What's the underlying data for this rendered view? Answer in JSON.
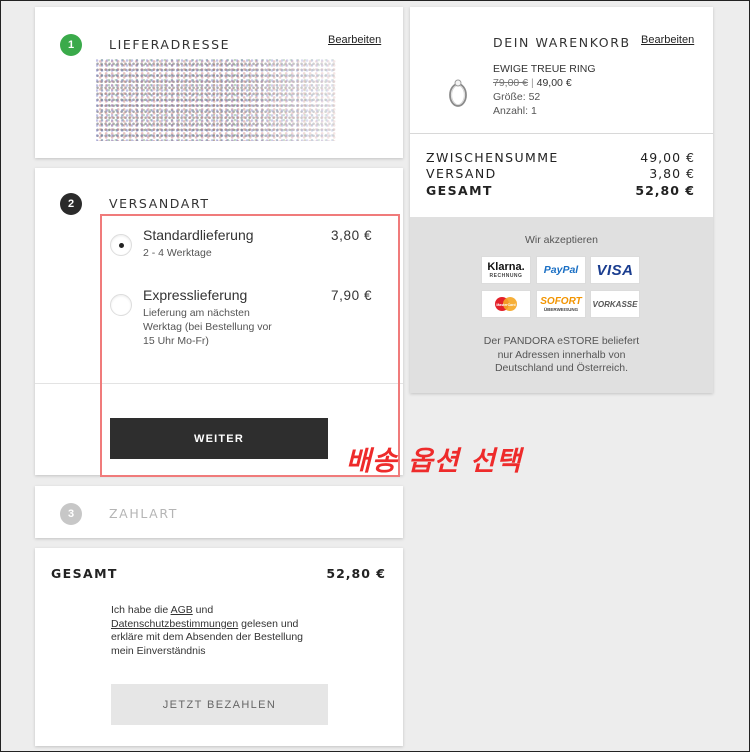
{
  "steps": {
    "address": {
      "number": "1",
      "title": "LIEFERADRESSE",
      "edit": "Bearbeiten"
    },
    "shipping": {
      "number": "2",
      "title": "VERSANDART"
    },
    "payment": {
      "number": "3",
      "title": "ZAHLART"
    }
  },
  "shipping_options": [
    {
      "name": "Standardlieferung",
      "sub": "2 - 4 Werktage",
      "price": "3,80 €",
      "selected": true
    },
    {
      "name": "Expresslieferung",
      "sub": "Lieferung am nächsten Werktag (bei Bestellung vor 15 Uhr Mo-Fr)",
      "price": "7,90 €",
      "selected": false
    }
  ],
  "weiter_button": "WEITER",
  "annotation": "배송 옵션 선택",
  "total_card": {
    "label": "GESAMT",
    "value": "52,80 €",
    "terms_prefix": "Ich habe die",
    "agb": "AGB",
    "und": "und",
    "privacy": "Datenschutzbestimmungen",
    "terms_suffix": "gelesen und erkläre mit dem Absenden der Bestellung mein Einverständnis",
    "pay_button": "JETZT BEZAHLEN"
  },
  "cart": {
    "title": "DEIN WARENKORB",
    "edit": "Bearbeiten",
    "item": {
      "name": "EWIGE TREUE RING",
      "old_price": "79,00 €",
      "separator": "|",
      "price": "49,00 €",
      "size": "Größe: 52",
      "qty": "Anzahl: 1"
    },
    "summary": {
      "subtotal_label": "ZWISCHENSUMME",
      "subtotal": "49,00 €",
      "shipping_label": "VERSAND",
      "shipping": "3,80 €",
      "total_label": "GESAMT",
      "total": "52,80 €"
    },
    "accept_title": "Wir akzeptieren",
    "payment_logos": [
      {
        "name": "Klarna.",
        "sub": "RECHNUNG"
      },
      {
        "name": "PayPal"
      },
      {
        "name": "VISA"
      },
      {
        "name": "MasterCard"
      },
      {
        "name": "SOFORT",
        "sub": "ÜBERWEISUNG"
      },
      {
        "name": "VORKASSE"
      }
    ],
    "footer_note": "Der PANDORA eSTORE beliefert nur Adressen innerhalb von Deutschland und Österreich."
  },
  "colors": {
    "step_active": "#3aaa4a",
    "step_current": "#2b2b2b",
    "step_inactive": "#c7c7c7",
    "annotation": "#ee2b2b"
  }
}
